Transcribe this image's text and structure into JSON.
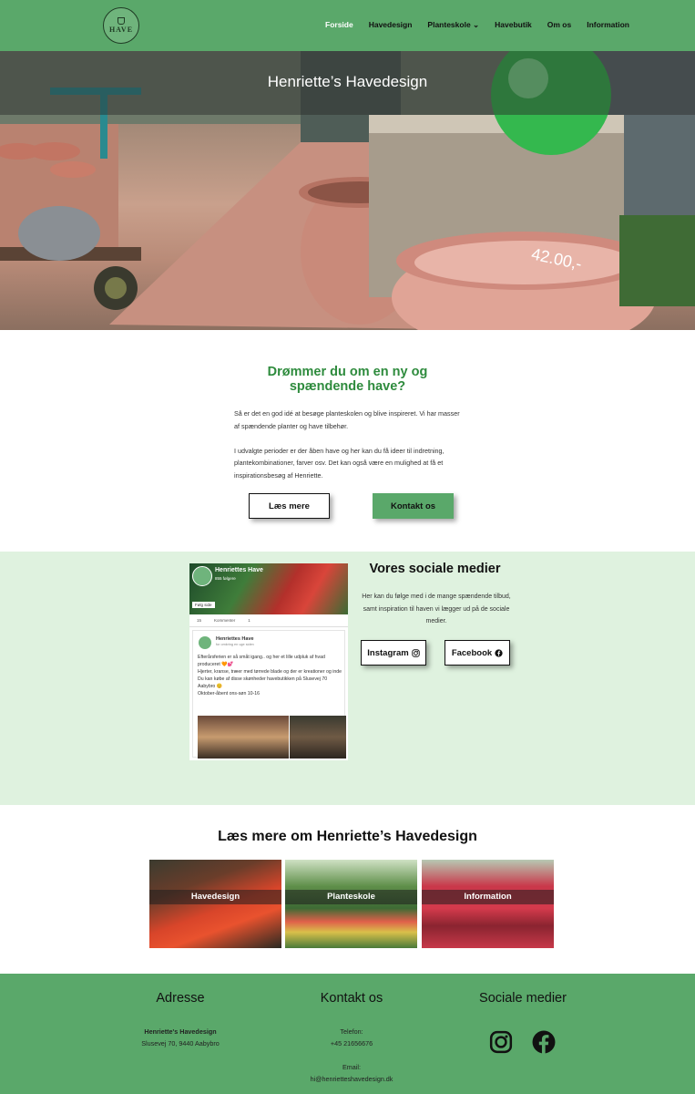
{
  "nav": {
    "logo_text": "HAVE",
    "items": [
      {
        "label": "Forside",
        "active": true
      },
      {
        "label": "Havedesign",
        "active": false
      },
      {
        "label": "Planteskole ⌄",
        "active": false
      },
      {
        "label": "Havebutik",
        "active": false
      },
      {
        "label": "Om os",
        "active": false
      },
      {
        "label": "Information",
        "active": false
      }
    ]
  },
  "hero": {
    "title": "Henriette’s Havedesign",
    "price_tag": "42.00,-"
  },
  "intro": {
    "heading": "Drømmer du om en ny og spændende have?",
    "para1": "Så er det en god idé at besøge planteskolen og blive inspireret. Vi har masser af spændende planter og have tilbehør.",
    "para2": "I udvalgte perioder er der åben have og her kan du få ideer til indretning, plantekombinationer, farver osv. Det kan også være en mulighed at få et inspirationsbesøg af Henriette.",
    "btn_more": "Læs mere",
    "btn_contact": "Kontakt os"
  },
  "facebook_widget": {
    "page_name": "Henriettes Have",
    "followers": "855 følgere",
    "like_btn": "Følg side",
    "likes": "15",
    "comment": "Kommenter",
    "shares": "1",
    "post_name": "Henriettes Have",
    "post_date": "for omkring en uge siden",
    "post_text1": "Efterårsferien er så småt igang.. og her et lille udpluk af hvad produceret 🧡💕",
    "post_text2": "Hjerter, kranse, træer med tørrede blade og der er kreationer og inde",
    "post_text3": "Du kan købe af disse skønheder havebutikken på Slusevej 70 Aabybro 😊",
    "post_text4": "Oktober-åbent ons-søn 10-16"
  },
  "social": {
    "heading": "Vores sociale medier",
    "text": "Her kan du følge med i de mange spændende tilbud, samt inspiration til haven vi lægger ud på de sociale medier.",
    "instagram": "Instagram",
    "facebook": "Facebook"
  },
  "read_more": {
    "heading": "Læs mere om Henriette’s Havedesign",
    "tiles": [
      {
        "label": "Havedesign"
      },
      {
        "label": "Planteskole"
      },
      {
        "label": "Information"
      }
    ]
  },
  "footer": {
    "address_h": "Adresse",
    "address_name": "Henriette's Havedesign",
    "address_line": "Slusevej 70, 9440 Aabybro",
    "contact_h": "Kontakt os",
    "phone_label": "Telefon:",
    "phone": "+45 21656676",
    "email_label": "Email:",
    "email": "hi@henrietteshavedesign.dk",
    "social_h": "Sociale medier"
  },
  "colors": {
    "brand_green": "#5aa86a",
    "heading_green": "#2e8b3d",
    "social_bg": "#dff2df"
  }
}
